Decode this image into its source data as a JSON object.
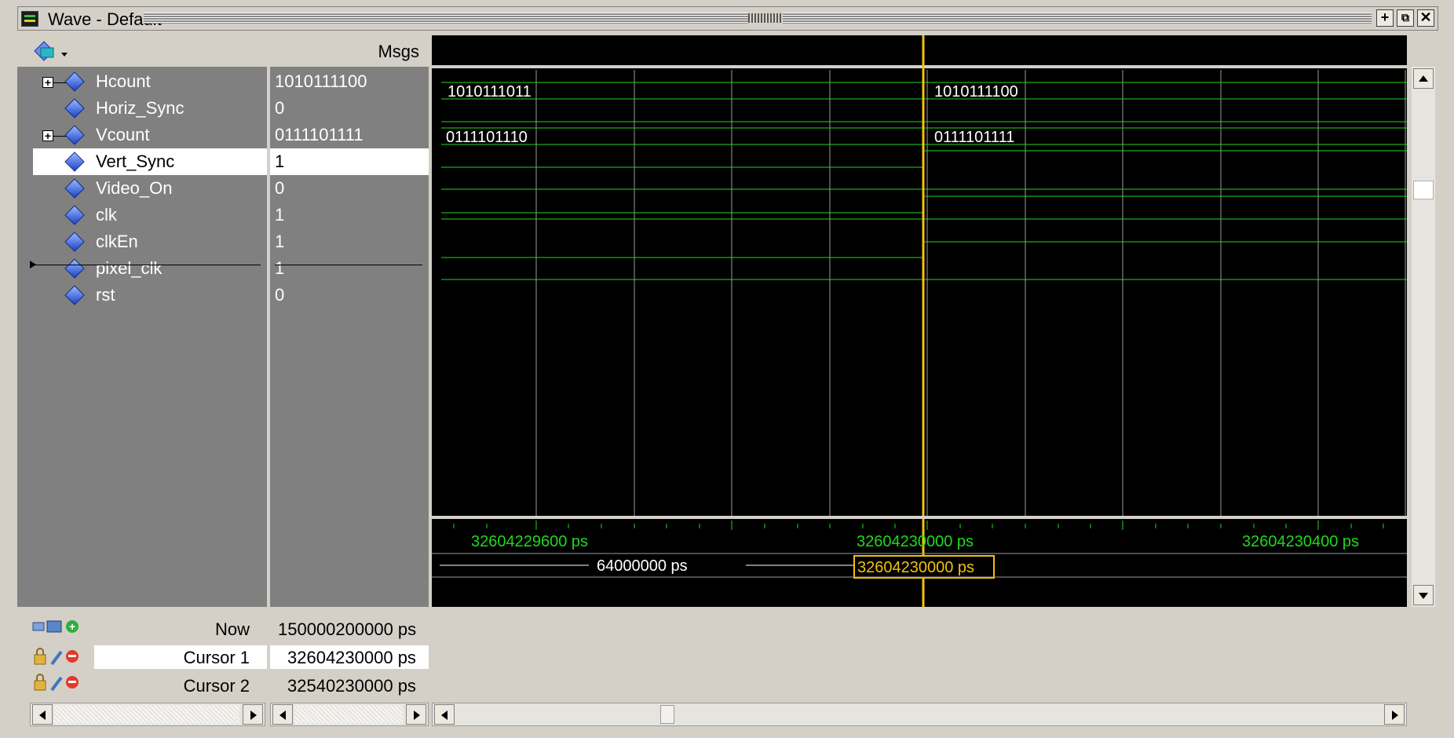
{
  "window": {
    "title": "Wave - Default"
  },
  "columns": {
    "msgs_header": "Msgs"
  },
  "signals": [
    {
      "name": "Hcount",
      "value": "1010111100",
      "expandable": true,
      "selected": false
    },
    {
      "name": "Horiz_Sync",
      "value": "0",
      "expandable": false,
      "selected": false
    },
    {
      "name": "Vcount",
      "value": "0111101111",
      "expandable": true,
      "selected": false
    },
    {
      "name": "Vert_Sync",
      "value": "1",
      "expandable": false,
      "selected": true
    },
    {
      "name": "Video_On",
      "value": "0",
      "expandable": false,
      "selected": false
    },
    {
      "name": "clk",
      "value": "1",
      "expandable": false,
      "selected": false
    },
    {
      "name": "clkEn",
      "value": "1",
      "expandable": false,
      "selected": false
    },
    {
      "name": "pixel_clk",
      "value": "1",
      "expandable": false,
      "selected": false
    },
    {
      "name": "rst",
      "value": "0",
      "expandable": false,
      "selected": false
    }
  ],
  "waves": {
    "bus_labels": [
      {
        "before": "1010111011",
        "after": "1010111100"
      },
      {
        "before": "0111101110",
        "after": "0111101111"
      }
    ]
  },
  "timeline": {
    "now_label": "Now",
    "now_value": "150000200000 ps",
    "cursor1_label": "Cursor 1",
    "cursor1_value": "32604230000 ps",
    "cursor2_label": "Cursor 2",
    "cursor2_value": "32540230000 ps",
    "ticks": [
      "32604229600 ps",
      "32604230000 ps",
      "32604230400 ps"
    ],
    "delta_label": "64000000 ps",
    "cursor_box_label": "32604230000 ps"
  },
  "colors": {
    "wave": "#1ed91e",
    "cursor": "#f3c10f",
    "grid": "#9a9a9a",
    "panel": "#808080"
  },
  "icons": [
    "app-icon",
    "add-icon",
    "restore-icon",
    "close-icon",
    "wave-format-icon",
    "diamond-signal-icon",
    "lock-icon",
    "wrench-icon",
    "delete-icon"
  ]
}
